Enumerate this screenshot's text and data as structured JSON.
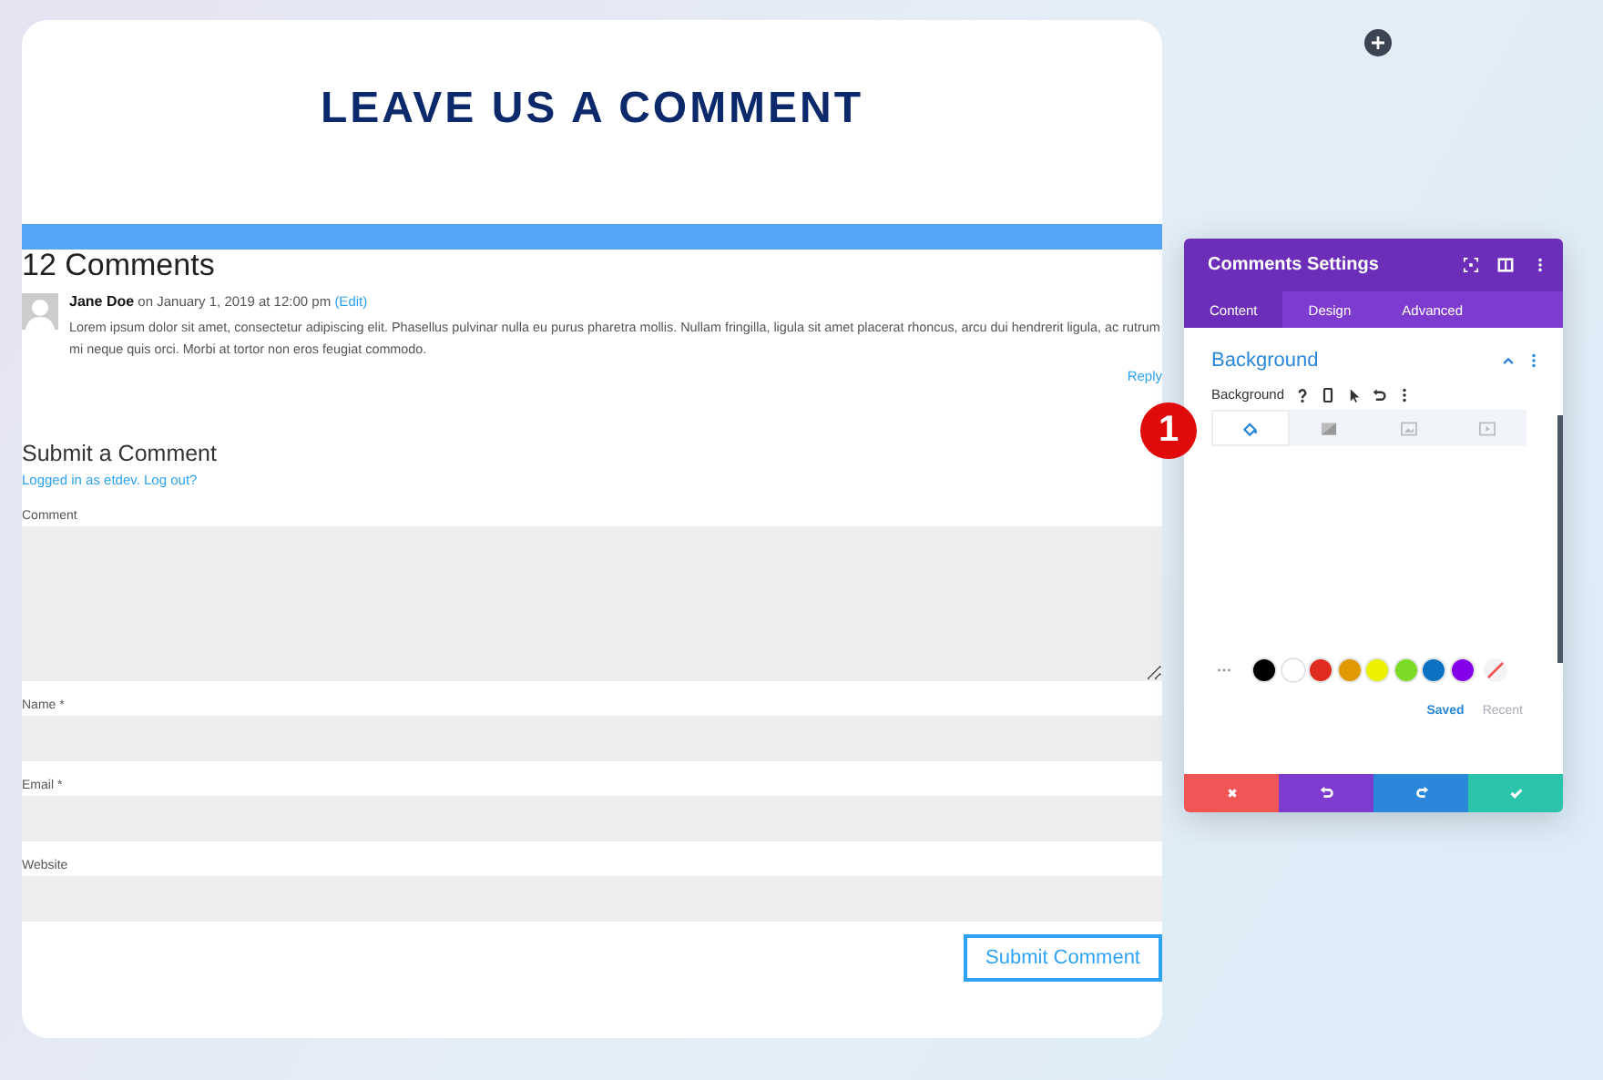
{
  "heading": "LEAVE US A COMMENT",
  "comments_title": "12 Comments",
  "comment": {
    "author": "Jane Doe",
    "date": "on January 1, 2019 at 12:00 pm",
    "edit": "(Edit)",
    "text": "Lorem ipsum dolor sit amet, consectetur adipiscing elit. Phasellus pulvinar nulla eu purus pharetra mollis. Nullam fringilla, ligula sit amet placerat rhoncus, arcu dui hendrerit ligula, ac rutrum mi neque quis orci. Morbi at tortor non eros feugiat commodo.",
    "reply": "Reply"
  },
  "form": {
    "title": "Submit a Comment",
    "logged_in": "Logged in as etdev.",
    "logout": "Log out?",
    "fields": [
      {
        "label": "Comment",
        "kind": "textarea"
      },
      {
        "label": "Name *",
        "kind": "input"
      },
      {
        "label": "Email *",
        "kind": "input"
      },
      {
        "label": "Website",
        "kind": "input"
      }
    ],
    "submit": "Submit Comment"
  },
  "settings": {
    "title": "Comments Settings",
    "tabs": [
      {
        "label": "Content",
        "selected": true
      },
      {
        "label": "Design",
        "selected": false
      },
      {
        "label": "Advanced",
        "selected": false
      }
    ],
    "section": "Background",
    "field_label": "Background",
    "bg_types": [
      {
        "kind": "color",
        "selected": true
      },
      {
        "kind": "gradient",
        "selected": false
      },
      {
        "kind": "image",
        "selected": false
      },
      {
        "kind": "video",
        "selected": false
      }
    ],
    "swatches": [
      {
        "color": "#000000"
      },
      {
        "color": "#ffffff"
      },
      {
        "color": "#e02b20"
      },
      {
        "color": "#e09900"
      },
      {
        "color": "#edf000"
      },
      {
        "color": "#7cda24"
      },
      {
        "color": "#0c71c3"
      },
      {
        "color": "#8300e9"
      }
    ],
    "palette_tabs": [
      {
        "label": "Saved",
        "selected": true
      },
      {
        "label": "Recent",
        "selected": false
      }
    ]
  },
  "step_badge": "1"
}
